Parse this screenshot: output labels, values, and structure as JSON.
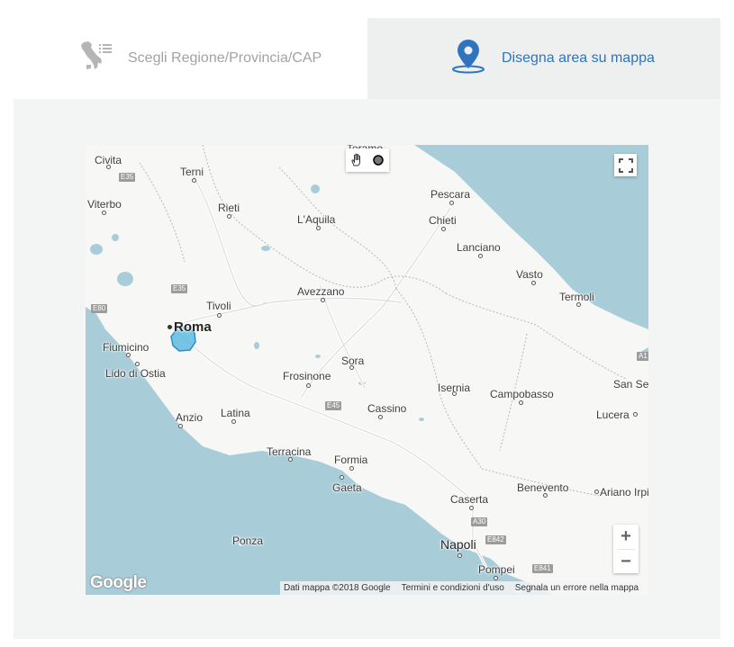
{
  "tabs": [
    {
      "label": "Scegli Regione/Provincia/CAP",
      "icon": "italy-list-icon",
      "active": false
    },
    {
      "label": "Disegna area su mappa",
      "icon": "map-pin-icon",
      "active": true
    }
  ],
  "colors": {
    "accent": "#2f74bd",
    "inactive": "#a3a3a3",
    "water": "#a8cdd8",
    "land": "#f7f7f6",
    "polygon": "#4ab3e0"
  },
  "map": {
    "places": [
      {
        "name": "Civita",
        "size": "small"
      },
      {
        "name": "Terni",
        "size": "small"
      },
      {
        "name": "Viterbo",
        "size": "small"
      },
      {
        "name": "Rieti",
        "size": "small"
      },
      {
        "name": "L'Aquila",
        "size": "small"
      },
      {
        "name": "Pescara",
        "size": "small"
      },
      {
        "name": "Chieti",
        "size": "small"
      },
      {
        "name": "Lanciano",
        "size": "small"
      },
      {
        "name": "Vasto",
        "size": "small"
      },
      {
        "name": "Termoli",
        "size": "small"
      },
      {
        "name": "Avezzano",
        "size": "small"
      },
      {
        "name": "Tivoli",
        "size": "small"
      },
      {
        "name": "Roma",
        "size": "big"
      },
      {
        "name": "Fiumicino",
        "size": "small"
      },
      {
        "name": "Lido di Ostia",
        "size": "small"
      },
      {
        "name": "Sora",
        "size": "small"
      },
      {
        "name": "Frosinone",
        "size": "small"
      },
      {
        "name": "Isernia",
        "size": "small"
      },
      {
        "name": "Campobasso",
        "size": "small"
      },
      {
        "name": "San Se",
        "size": "small"
      },
      {
        "name": "Cassino",
        "size": "small"
      },
      {
        "name": "Latina",
        "size": "small"
      },
      {
        "name": "Anzio",
        "size": "small"
      },
      {
        "name": "Lucera",
        "size": "small"
      },
      {
        "name": "Terracina",
        "size": "small"
      },
      {
        "name": "Formia",
        "size": "small"
      },
      {
        "name": "Gaeta",
        "size": "small"
      },
      {
        "name": "Benevento",
        "size": "small"
      },
      {
        "name": "Ariano Irpi",
        "size": "small"
      },
      {
        "name": "Caserta",
        "size": "small"
      },
      {
        "name": "Ponza",
        "size": "small"
      },
      {
        "name": "Napoli",
        "size": "mid"
      },
      {
        "name": "Pompei",
        "size": "small"
      },
      {
        "name": "Teramo",
        "size": "small"
      }
    ],
    "roads": [
      "E35",
      "E35",
      "E80",
      "E45",
      "A1",
      "A30",
      "E842",
      "E841"
    ],
    "zoom_in": "+",
    "zoom_out": "−",
    "logo": "Google",
    "attribution": [
      "Dati mappa ©2018 Google",
      "Termini e condizioni d'uso",
      "Segnala un errore nella mappa"
    ]
  }
}
